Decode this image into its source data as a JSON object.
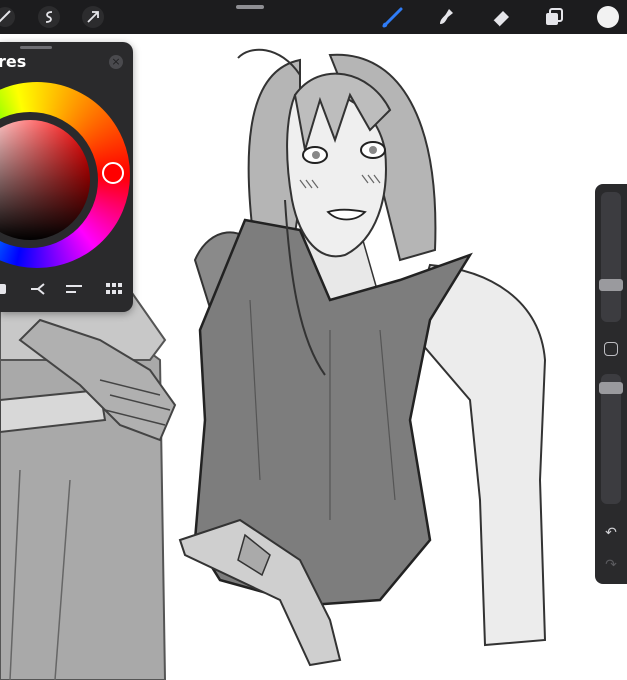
{
  "toolbar": {
    "tools": [
      {
        "icon": "brush-icon",
        "active": true
      },
      {
        "icon": "smudge-icon",
        "active": false
      },
      {
        "icon": "eraser-icon",
        "active": false
      },
      {
        "icon": "layers-icon",
        "active": false
      }
    ],
    "left_icons": [
      "adjustments-icon",
      "selection-icon",
      "transform-icon"
    ],
    "accent": "#2f7cf6",
    "current_color": "#f2f2f2"
  },
  "colors_panel": {
    "title": "res",
    "close_symbol": "×",
    "selected_hue": "#ff0000",
    "tabs": [
      "disc-tab",
      "harmony-tab",
      "value-tab",
      "palettes-tab"
    ]
  },
  "sidebar": {
    "undo_symbol": "↶",
    "redo_symbol": "↷"
  }
}
